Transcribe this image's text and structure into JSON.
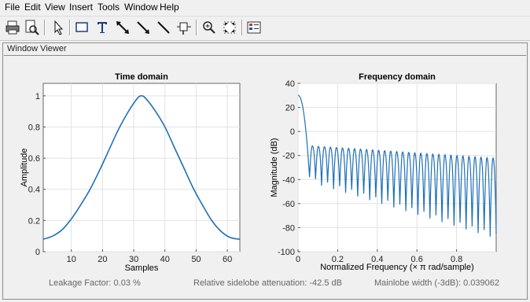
{
  "menu": [
    "File",
    "Edit",
    "View",
    "Insert",
    "Tools",
    "Window",
    "Help"
  ],
  "toolbar": {
    "buttons": [
      {
        "name": "print-icon"
      },
      {
        "name": "print-preview-icon"
      },
      {
        "name": "select-arrow-icon"
      },
      {
        "name": "insert-rectangle-icon"
      },
      {
        "name": "insert-text-icon"
      },
      {
        "name": "insert-double-arrow-icon"
      },
      {
        "name": "insert-arrow-icon"
      },
      {
        "name": "insert-line-icon"
      },
      {
        "name": "data-cursor-icon"
      },
      {
        "name": "zoom-in-icon"
      },
      {
        "name": "fit-to-view-icon"
      },
      {
        "name": "legend-icon"
      }
    ]
  },
  "panel": {
    "title": "Window Viewer"
  },
  "colors": {
    "line": "#1f6fb8",
    "grid": "#e2e2e2",
    "axes_bg": "#ffffff"
  },
  "chart_data": [
    {
      "type": "line",
      "title": "Time domain",
      "xlabel": "Samples",
      "ylabel": "Amplitude",
      "xlim": [
        1,
        64
      ],
      "ylim": [
        0,
        1.08
      ],
      "xticks": [
        10,
        20,
        30,
        40,
        50,
        60
      ],
      "yticks": [
        0,
        0.2,
        0.4,
        0.6,
        0.8,
        1
      ],
      "xtick_labels": [
        "10",
        "20",
        "30",
        "40",
        "50",
        "60"
      ],
      "ytick_labels": [
        "0",
        "0.2",
        "0.4",
        "0.6",
        "0.8",
        "1"
      ],
      "grid": true,
      "series": [
        {
          "x": [
            1,
            4,
            7,
            10,
            13,
            16,
            19,
            22,
            25,
            28,
            31,
            32.5,
            34,
            37,
            40,
            43,
            46,
            49,
            52,
            55,
            58,
            61,
            64
          ],
          "y": [
            0.08,
            0.1,
            0.14,
            0.21,
            0.3,
            0.4,
            0.52,
            0.65,
            0.78,
            0.89,
            0.98,
            1.0,
            0.98,
            0.9,
            0.8,
            0.67,
            0.54,
            0.41,
            0.3,
            0.2,
            0.13,
            0.09,
            0.08
          ]
        }
      ]
    },
    {
      "type": "line",
      "title": "Frequency domain",
      "xlabel": "Normalized Frequency  (× π rad/sample)",
      "ylabel": "Magnitude (dB)",
      "xlim": [
        0,
        1
      ],
      "ylim": [
        -100,
        40
      ],
      "xticks": [
        0,
        0.2,
        0.4,
        0.6,
        0.8
      ],
      "yticks": [
        -100,
        -80,
        -60,
        -40,
        -20,
        0,
        20,
        40
      ],
      "xtick_labels": [
        "0",
        "0.2",
        "0.4",
        "0.6",
        "0.8"
      ],
      "ytick_labels": [
        "-100",
        "-80",
        "-60",
        "-40",
        "-20",
        "0",
        "20",
        "40"
      ],
      "grid": true,
      "mainlobe_peak_db": 30,
      "sidelobe_peak_db_range": [
        -12,
        -22
      ],
      "null_depth_db_range": [
        -38,
        -85
      ],
      "sidelobe_count": 31
    }
  ],
  "status": {
    "leakage": "Leakage Factor: 0.03 %",
    "sidelobe": "Relative sidelobe attenuation: -42.5 dB",
    "mainlobe": "Mainlobe width (-3dB): 0.039062"
  }
}
